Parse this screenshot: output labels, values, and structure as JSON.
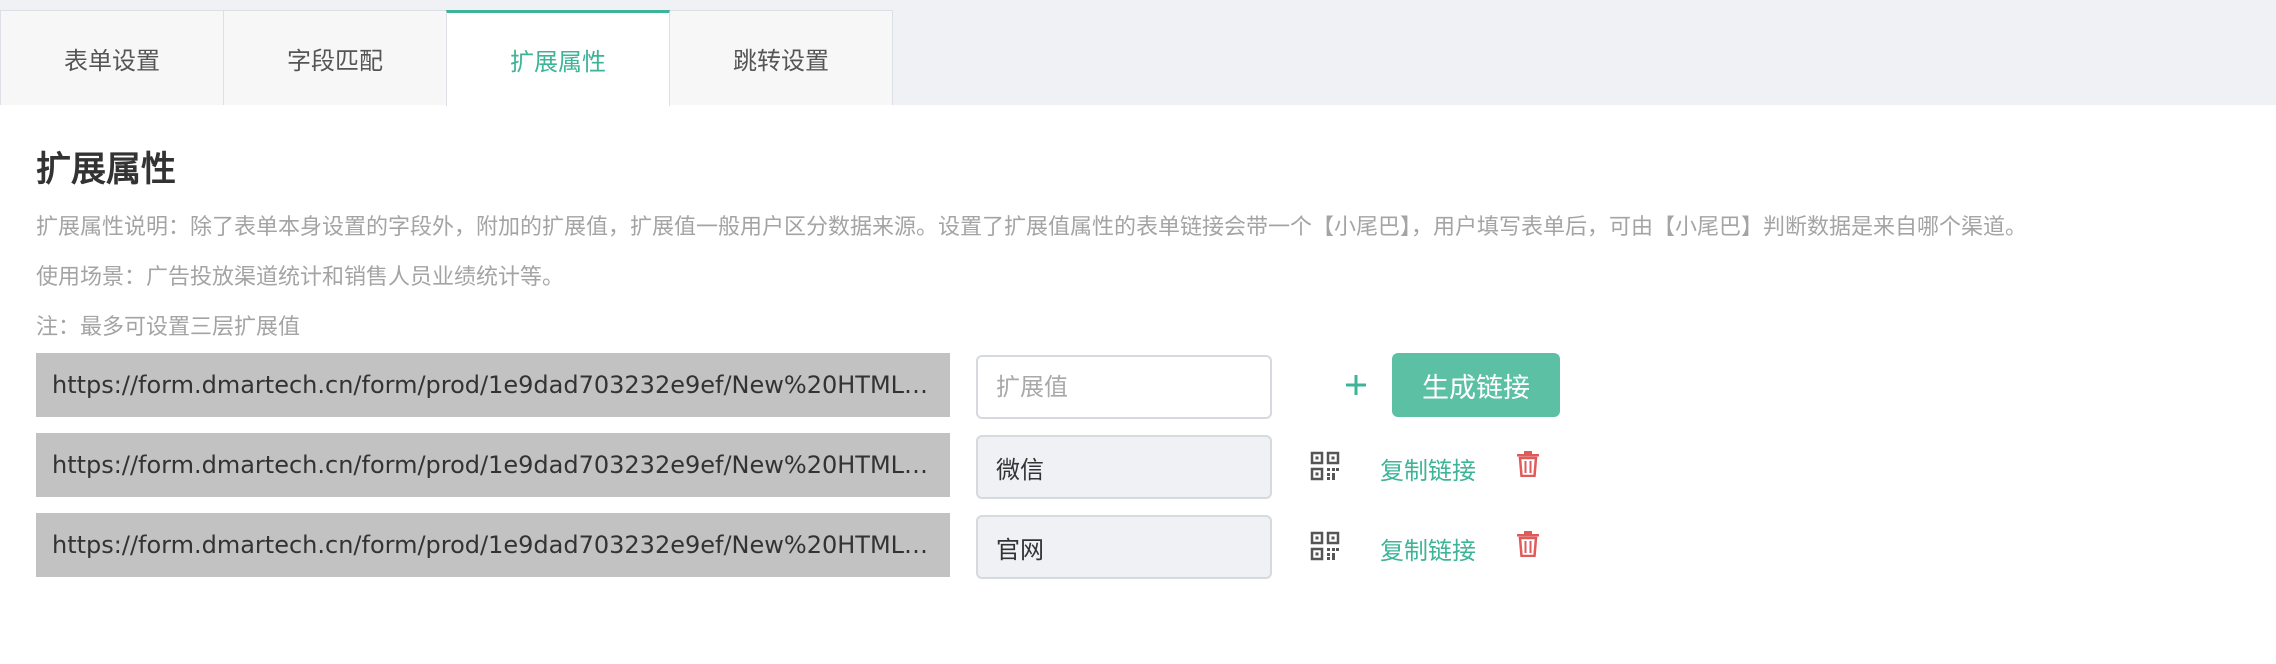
{
  "tabs": [
    {
      "label": "表单设置"
    },
    {
      "label": "字段匹配"
    },
    {
      "label": "扩展属性"
    },
    {
      "label": "跳转设置"
    }
  ],
  "active_tab": "扩展属性",
  "accent_color": "#3db497",
  "heading": "扩展属性",
  "description": {
    "line1": "扩展属性说明：除了表单本身设置的字段外，附加的扩展值，扩展值一般用户区分数据来源。设置了扩展值属性的表单链接会带一个【小尾巴】，用户填写表单后，可由【小尾巴】判断数据是来自哪个渠道。",
    "line2": "使用场景：广告投放渠道统计和销售人员业绩统计等。",
    "line3": "注：最多可设置三层扩展值"
  },
  "new_row": {
    "url": "https://form.dmartech.cn/form/prod/1e9dad703232e9ef/New%20HTML%2020...",
    "placeholder": "扩展值",
    "value": "",
    "plus_icon": "plus-icon",
    "generate_label": "生成链接"
  },
  "rows": [
    {
      "url": "https://form.dmartech.cn/form/prod/1e9dad703232e9ef/New%20HTML%2020...",
      "ext_value": "微信",
      "qr_icon": "qr-code-icon",
      "copy_label": "复制链接",
      "delete_icon": "trash-icon"
    },
    {
      "url": "https://form.dmartech.cn/form/prod/1e9dad703232e9ef/New%20HTML%2020...",
      "ext_value": "官网",
      "qr_icon": "qr-code-icon",
      "copy_label": "复制链接",
      "delete_icon": "trash-icon"
    }
  ]
}
